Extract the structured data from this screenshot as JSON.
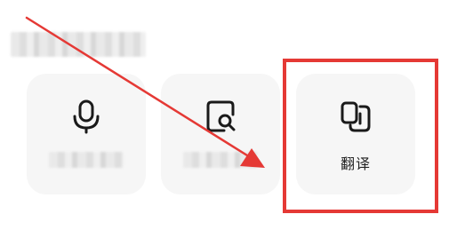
{
  "header": {
    "title_redacted": true
  },
  "cards": [
    {
      "id": "voice",
      "icon": "microphone-icon",
      "label": "",
      "label_redacted": true
    },
    {
      "id": "scan",
      "icon": "document-search-icon",
      "label": "",
      "label_redacted": true
    },
    {
      "id": "translate",
      "icon": "translate-icon",
      "label": "翻译",
      "label_redacted": false
    }
  ],
  "annotations": {
    "highlight_color": "#e53935",
    "arrow_color": "#e53935",
    "highlighted_card": "translate"
  },
  "colors": {
    "card_background": "#f6f6f6",
    "icon_stroke": "#1a1a1a",
    "label_text": "#222222"
  }
}
